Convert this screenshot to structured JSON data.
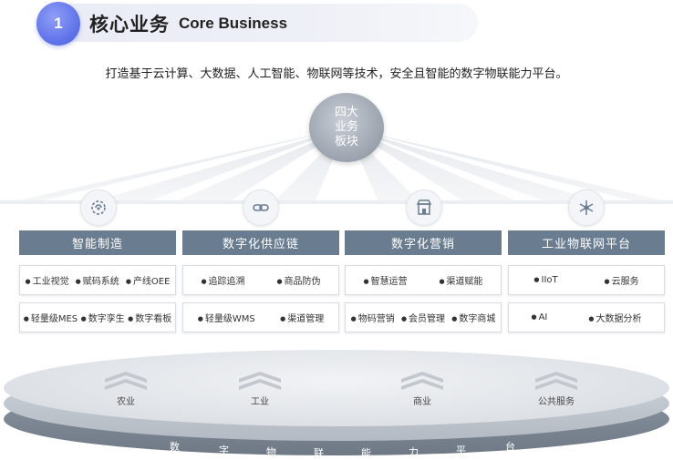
{
  "header": {
    "number": "1",
    "title_cn": "核心业务",
    "title_en": "Core Business"
  },
  "subtitle": "打造基于云计算、大数据、人工智能、物联网等技术，安全且智能的数字物联能力平台。",
  "hub": {
    "label": "四大业务板块"
  },
  "columns": [
    {
      "title": "智能制造",
      "icon": "gear-brain-icon",
      "rows": [
        [
          "工业视觉",
          "赋码系统",
          "产线OEE"
        ],
        [
          "轻量级MES",
          "数字孪生",
          "数字看板"
        ]
      ]
    },
    {
      "title": "数字化供应链",
      "icon": "link-icon",
      "rows": [
        [
          "追踪追溯",
          "商品防伪"
        ],
        [
          "轻量级WMS",
          "渠道管理"
        ]
      ]
    },
    {
      "title": "数字化营销",
      "icon": "store-icon",
      "rows": [
        [
          "智慧运营",
          "渠道赋能"
        ],
        [
          "物码营销",
          "会员管理",
          "数字商城"
        ]
      ]
    },
    {
      "title": "工业物联网平台",
      "icon": "snowflake-network-icon",
      "rows": [
        [
          "IIoT",
          "云服务"
        ],
        [
          "AI",
          "大数据分析"
        ]
      ]
    }
  ],
  "platform": {
    "sectors": [
      "农业",
      "工业",
      "商业",
      "公共服务"
    ],
    "base_chars": [
      "数",
      "字",
      "物",
      "联",
      "能",
      "力",
      "平",
      "台"
    ]
  },
  "colors": {
    "accent": "#5b6fe8",
    "column_header": "#6a7c8f",
    "hub": "#9aa2ad"
  }
}
